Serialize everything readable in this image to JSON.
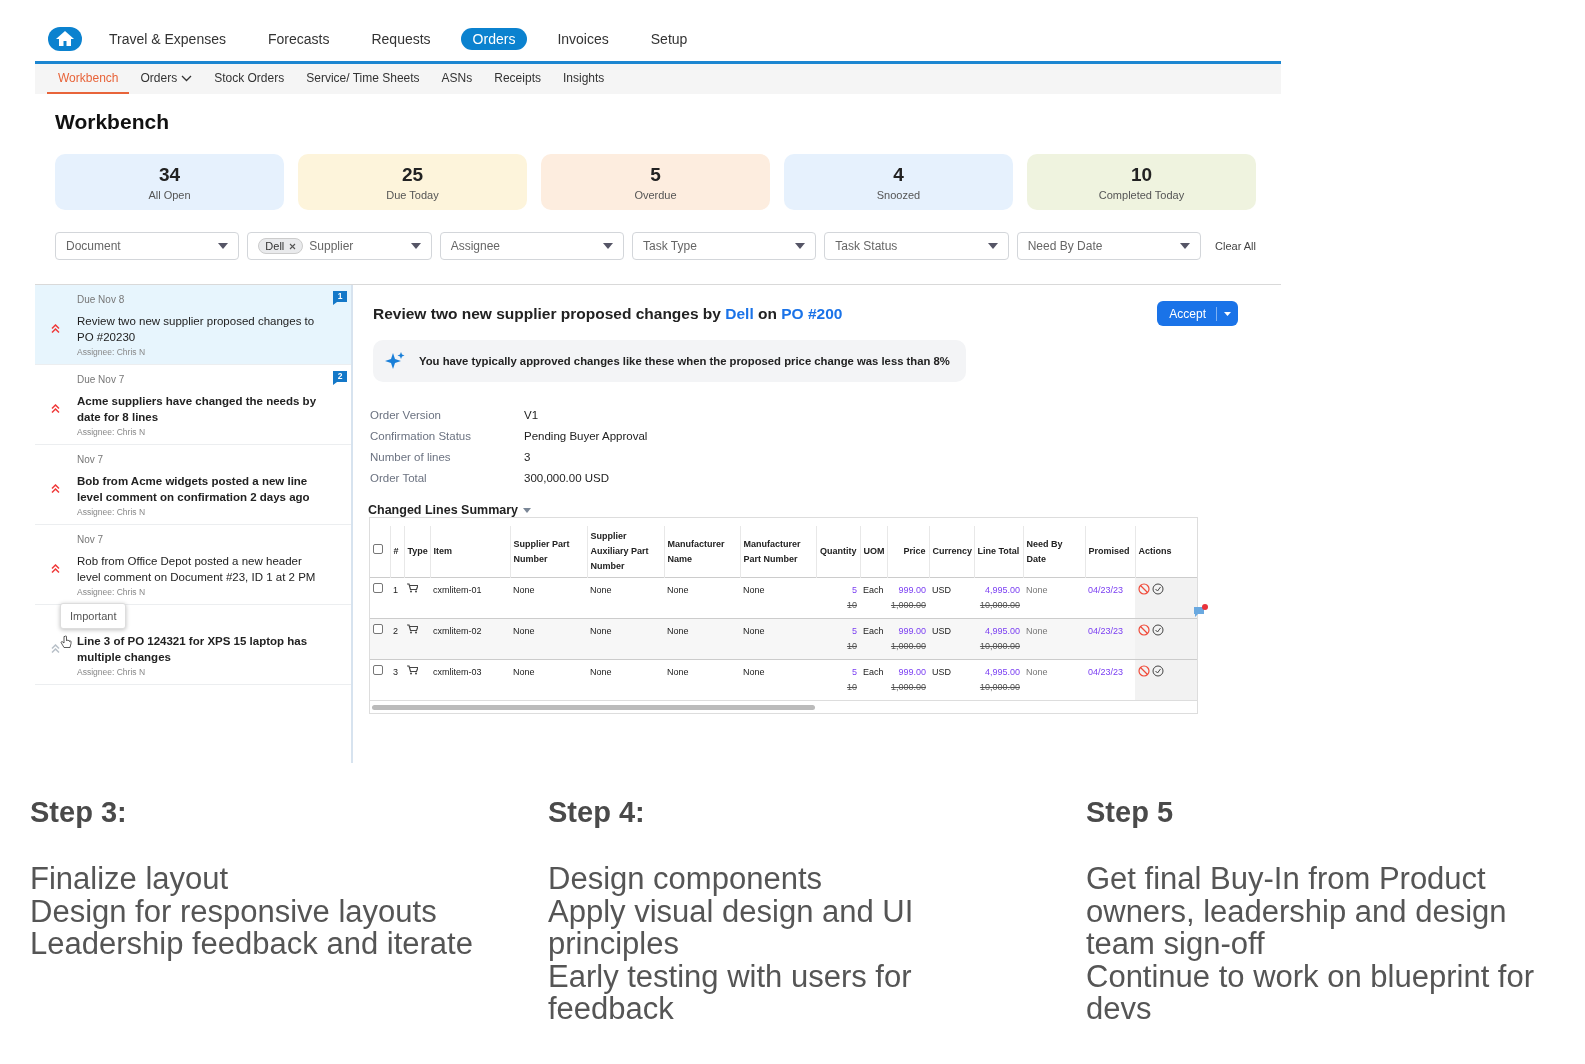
{
  "nav": {
    "tabs": [
      {
        "label": "Travel & Expenses",
        "selected": false
      },
      {
        "label": "Forecasts",
        "selected": false
      },
      {
        "label": "Requests",
        "selected": false
      },
      {
        "label": "Orders",
        "selected": true
      },
      {
        "label": "Invoices",
        "selected": false
      },
      {
        "label": "Setup",
        "selected": false
      }
    ],
    "subtabs": [
      {
        "label": "Workbench",
        "selected": true,
        "menu": false
      },
      {
        "label": "Orders",
        "selected": false,
        "menu": true
      },
      {
        "label": "Stock Orders",
        "selected": false,
        "menu": false
      },
      {
        "label": "Service/ Time Sheets",
        "selected": false,
        "menu": false
      },
      {
        "label": "ASNs",
        "selected": false,
        "menu": false
      },
      {
        "label": "Receipts",
        "selected": false,
        "menu": false
      },
      {
        "label": "Insights",
        "selected": false,
        "menu": false
      }
    ]
  },
  "page_title": "Workbench",
  "stats": [
    {
      "count": "34",
      "label": "All Open",
      "color": "#e6f1fd"
    },
    {
      "count": "25",
      "label": "Due Today",
      "color": "#fdf4db"
    },
    {
      "count": "5",
      "label": "Overdue",
      "color": "#fdeddf"
    },
    {
      "count": "4",
      "label": "Snoozed",
      "color": "#e6f1fd"
    },
    {
      "count": "10",
      "label": "Completed Today",
      "color": "#eff3df"
    }
  ],
  "filters": [
    {
      "label": "Document"
    },
    {
      "label": "Supplier",
      "chip": "Dell"
    },
    {
      "label": "Assignee"
    },
    {
      "label": "Task Type"
    },
    {
      "label": "Task Status"
    },
    {
      "label": "Need By Date"
    }
  ],
  "clear_all": "Clear All",
  "tasks": [
    {
      "date": "Due Nov 8",
      "title": "Review two new supplier proposed changes to PO #20230",
      "bold": false,
      "assignee": "Assignee: Chris N",
      "badge": "1",
      "important": true,
      "selected": true
    },
    {
      "date": "Due Nov 7",
      "title": "Acme suppliers have changed the needs by date for 8 lines",
      "bold": true,
      "assignee": "Assignee: Chris N",
      "badge": "2",
      "important": true,
      "selected": false
    },
    {
      "date": "Nov 7",
      "title": "Bob from Acme widgets posted a new line level comment on confirmation 2 days ago",
      "bold": true,
      "assignee": "Assignee: Chris N",
      "important": true,
      "selected": false
    },
    {
      "date": "Nov 7",
      "title": "Rob from Office Depot posted a new header level comment on Document #23, ID 1 at 2 PM",
      "bold": false,
      "assignee": "Assignee: Chris N",
      "important": true,
      "selected": false
    },
    {
      "title": "Line 3 of PO 124321 for XPS 15 laptop has multiple changes",
      "bold": true,
      "assignee": "Assignee: Chris N",
      "important": false,
      "selected": false
    }
  ],
  "tooltip": "Important",
  "detail": {
    "title": [
      {
        "text": "Review two new supplier proposed changes by ",
        "link": false
      },
      {
        "text": "Dell",
        "link": true
      },
      {
        "text": " on ",
        "link": false
      },
      {
        "text": "PO #200",
        "link": true
      }
    ],
    "accept": "Accept",
    "insight": "You have typically approved changes like these when the proposed price change was less than 8%",
    "fields": [
      {
        "label": "Order Version",
        "value": "V1"
      },
      {
        "label": "Confirmation Status",
        "value": "Pending Buyer Approval"
      },
      {
        "label": "Number of lines",
        "value": "3"
      },
      {
        "label": "Order Total",
        "value": "300,000.00 USD"
      }
    ],
    "summary_title": "Changed Lines Summary",
    "table": {
      "header_checked": false,
      "columns": [
        "#",
        "Type",
        "Item",
        "Supplier Part Number",
        "Supplier Auxiliary Part Number",
        "Manufacturer Name",
        "Manufacturer Part Number",
        "Quantity",
        "UOM",
        "Price",
        "Currency",
        "Line Total",
        "Need By Date",
        "Promised",
        "Actions"
      ],
      "rows": [
        {
          "checked": false,
          "num": "1",
          "item": "cxmlitem-01",
          "supplier_part": "None",
          "aux_part": "None",
          "mfr_name": "None",
          "mfr_part": "None",
          "qty": "5",
          "qty_old": "10",
          "uom": "Each",
          "price": "999.00",
          "price_old": "1,000.00",
          "currency": "USD",
          "total": "4,995.00",
          "total_old": "10,000.00",
          "need_by": "None",
          "promised": "04/23/23"
        },
        {
          "checked": false,
          "num": "2",
          "item": "cxmlitem-02",
          "supplier_part": "None",
          "aux_part": "None",
          "mfr_name": "None",
          "mfr_part": "None",
          "qty": "5",
          "qty_old": "10",
          "uom": "Each",
          "price": "999.00",
          "price_old": "1,000.00",
          "currency": "USD",
          "total": "4,995.00",
          "total_old": "10,000.00",
          "need_by": "None",
          "promised": "04/23/23"
        },
        {
          "checked": false,
          "num": "3",
          "item": "cxmlitem-03",
          "supplier_part": "None",
          "aux_part": "None",
          "mfr_name": "None",
          "mfr_part": "None",
          "qty": "5",
          "qty_old": "10",
          "uom": "Each",
          "price": "999.00",
          "price_old": "1,000.00",
          "currency": "USD",
          "total": "4,995.00",
          "total_old": "10,000.00",
          "need_by": "None",
          "promised": "04/23/23"
        }
      ]
    }
  },
  "steps": [
    {
      "heading": "Step 3:",
      "lines": [
        "Finalize layout",
        "Design for responsive layouts",
        "Leadership feedback and iterate"
      ]
    },
    {
      "heading": "Step 4:",
      "lines": [
        "Design components",
        "Apply visual design and UI principles",
        "Early testing with users for feedback"
      ]
    },
    {
      "heading": "Step 5",
      "lines": [
        "Get final Buy-In from Product owners, leadership and design team sign-off",
        "Continue to work on blueprint for devs"
      ]
    }
  ]
}
